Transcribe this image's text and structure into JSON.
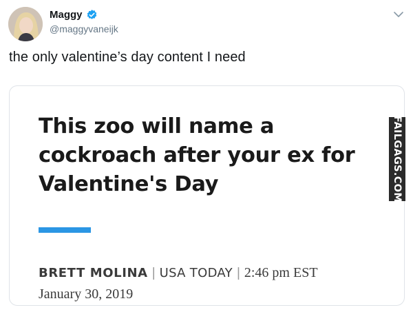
{
  "tweet": {
    "display_name": "Maggy",
    "handle": "@maggyvaneijk",
    "text": "the only valentine’s day content I need",
    "verified_icon": "verified-badge-icon",
    "menu_icon": "chevron-down-icon"
  },
  "card": {
    "headline": "This zoo will name a cockroach after your ex for Valentine's Day",
    "author": "BRETT MOLINA",
    "separator": "|",
    "outlet": "USA TODAY",
    "separator2": "|",
    "time": "2:46 pm EST",
    "date": "January 30, 2019",
    "accent_color": "#2b96e4"
  },
  "watermark": {
    "text": "FAILGAGS.COM"
  },
  "colors": {
    "verified_blue": "#1da1f2",
    "handle_gray": "#657786"
  }
}
